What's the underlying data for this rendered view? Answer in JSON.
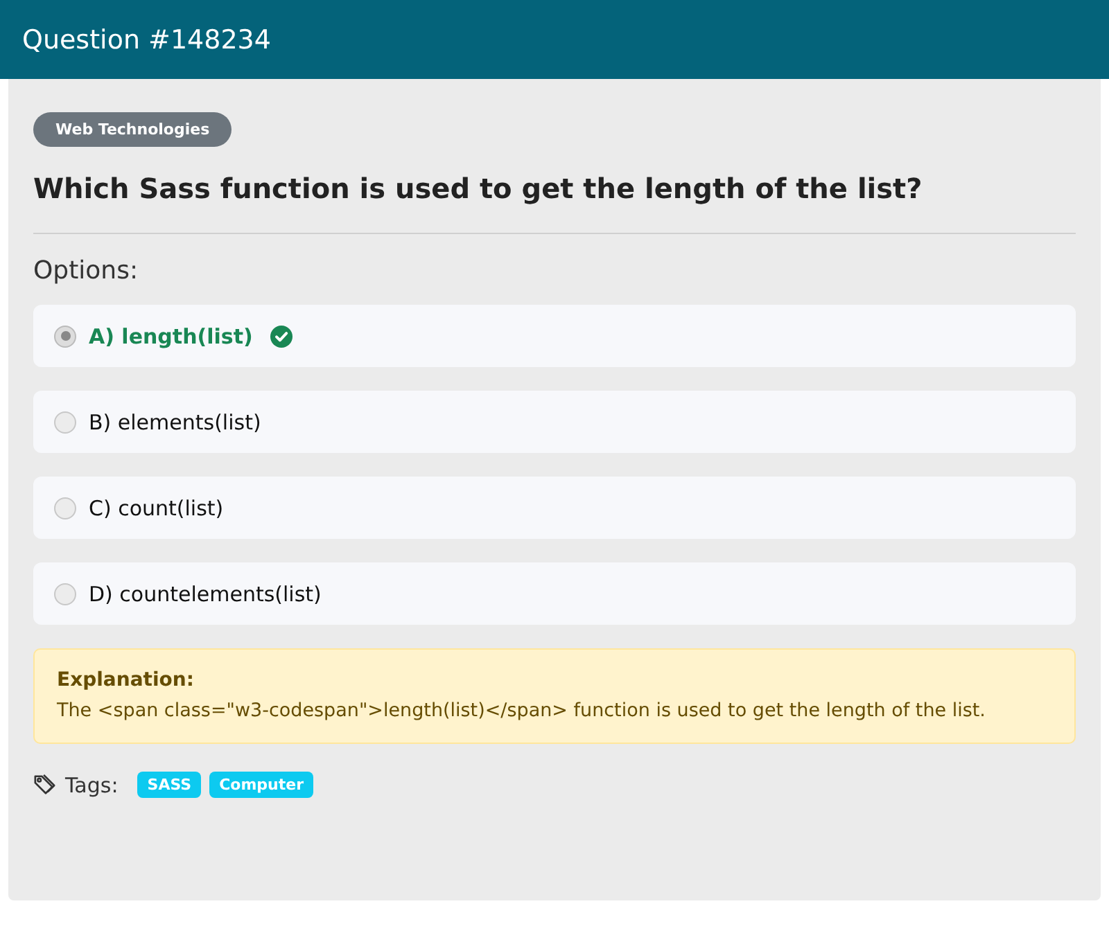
{
  "header": {
    "title": "Question #148234"
  },
  "category": "Web Technologies",
  "question": "Which Sass function is used to get the length of the list?",
  "options_label": "Options:",
  "options": [
    {
      "label": "A) length(list)",
      "selected": true,
      "correct": true
    },
    {
      "label": "B) elements(list)",
      "selected": false,
      "correct": false
    },
    {
      "label": "C) count(list)",
      "selected": false,
      "correct": false
    },
    {
      "label": "D) countelements(list)",
      "selected": false,
      "correct": false
    }
  ],
  "explanation": {
    "title": "Explanation:",
    "text": "The <span class=\"w3-codespan\">length(list)</span> function is used to get the length of the list."
  },
  "tags_label": "Tags:",
  "tags": [
    "SASS",
    "Computer"
  ]
}
